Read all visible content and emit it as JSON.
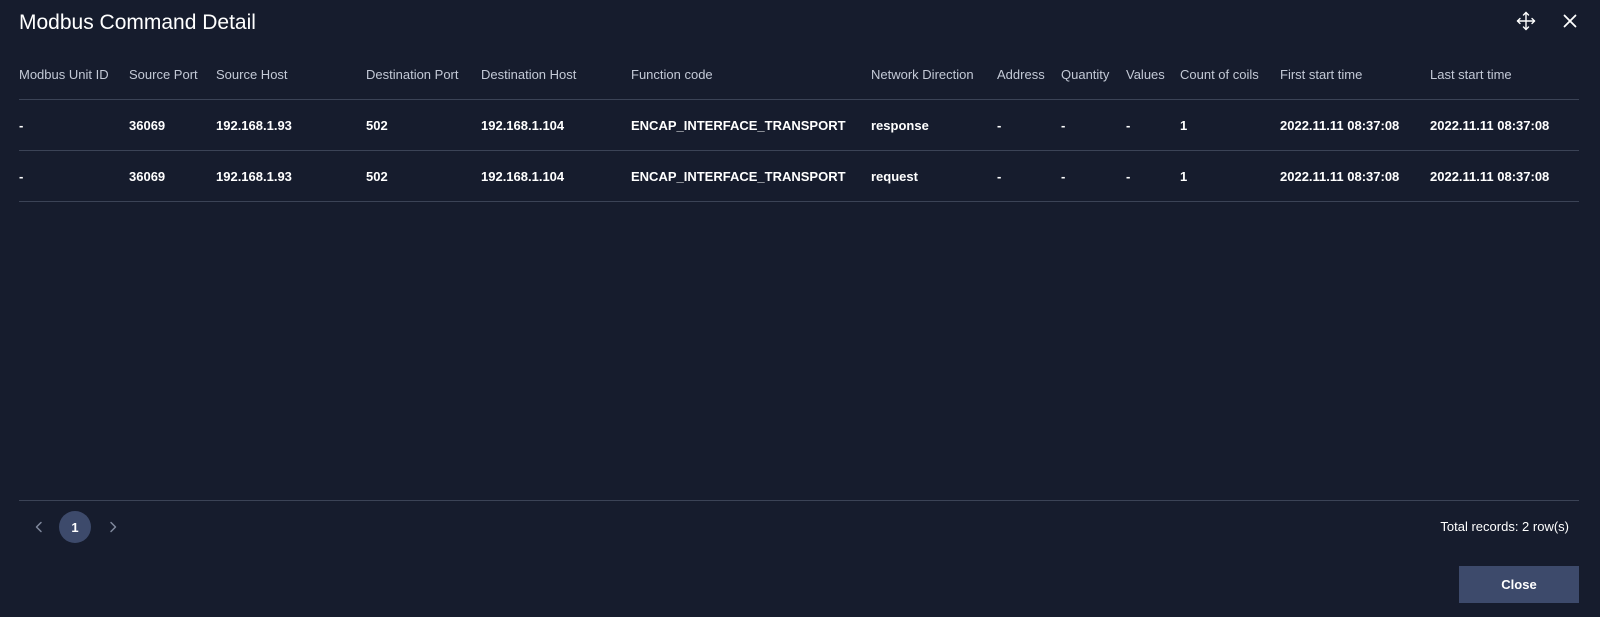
{
  "dialog": {
    "title": "Modbus Command Detail"
  },
  "icons": {
    "move": "move-icon",
    "close": "close-icon"
  },
  "table": {
    "columns": [
      "Modbus Unit ID",
      "Source Port",
      "Source Host",
      "Destination Port",
      "Destination Host",
      "Function code",
      "Network Direction",
      "Address",
      "Quantity",
      "Values",
      "Count of coils",
      "First start time",
      "Last start time"
    ],
    "rows": [
      [
        "-",
        "36069",
        "192.168.1.93",
        "502",
        "192.168.1.104",
        "ENCAP_INTERFACE_TRANSPORT",
        "response",
        "-",
        "-",
        "-",
        "1",
        "2022.11.11 08:37:08",
        "2022.11.11 08:37:08"
      ],
      [
        "-",
        "36069",
        "192.168.1.93",
        "502",
        "192.168.1.104",
        "ENCAP_INTERFACE_TRANSPORT",
        "request",
        "-",
        "-",
        "-",
        "1",
        "2022.11.11 08:37:08",
        "2022.11.11 08:37:08"
      ]
    ]
  },
  "pagination": {
    "current_page": "1",
    "total_records": "Total records: 2 row(s)"
  },
  "footer": {
    "close_label": "Close"
  },
  "colors": {
    "background": "#161c2d",
    "divider": "#3b4356",
    "accent": "#3d4a6b",
    "header_text": "#c3c9d6"
  }
}
